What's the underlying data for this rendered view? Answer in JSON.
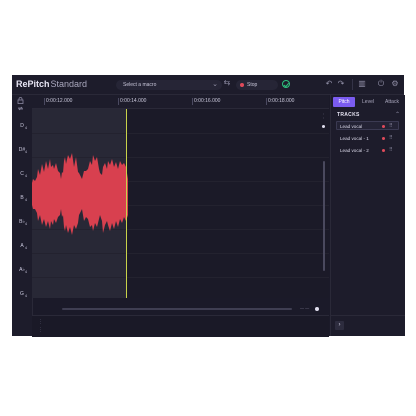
{
  "app": {
    "brand_name": "RePitch",
    "brand_edition": "Standard"
  },
  "toolbar": {
    "macro_placeholder": "Select a macro",
    "stop_label": "Stop",
    "undo_glyph": "↶",
    "redo_glyph": "↷",
    "swap_glyph": "⇆",
    "layout_glyph": "▥",
    "power_glyph": "⏻",
    "settings_glyph": "⚙",
    "chevron_glyph": "⌄",
    "status_color": "#2ec27e",
    "stop_color": "#e04a5b"
  },
  "ruler": {
    "times": [
      "0:00:12.000",
      "0:00:14.000",
      "0:00:16.000",
      "0:00:18.000"
    ]
  },
  "notes": [
    "D",
    "D#",
    "C",
    "B",
    "B♭",
    "A",
    "A♭",
    "G"
  ],
  "note_octave": "4",
  "panel": {
    "tabs": [
      "Pitch",
      "Level",
      "Attack"
    ],
    "active_tab": "Pitch",
    "tracks_heading": "TRACKS",
    "tracks_collapse_glyph": "⌃",
    "tracks": [
      {
        "name": "Lead vocal",
        "selected": true
      },
      {
        "name": "Lead vocal - 1",
        "selected": false
      },
      {
        "name": "Lead vocal - 2",
        "selected": false
      }
    ],
    "expand_glyph": "›"
  },
  "colors": {
    "accent": "#7b5cf0",
    "waveform": "#d8404f",
    "playhead": "#c8d34a",
    "background": "#1b1a29"
  },
  "icons": {
    "lock": "lock-icon",
    "loop": "loop-icon",
    "drag": "drag-handle-icon"
  }
}
